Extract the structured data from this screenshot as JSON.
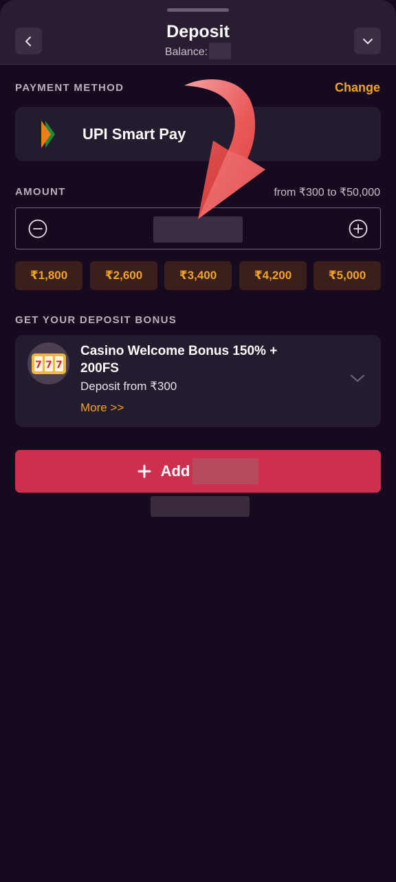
{
  "header": {
    "title": "Deposit",
    "balance_label": "Balance:",
    "back_icon": "chevron-left-icon",
    "collapse_icon": "chevron-down-icon"
  },
  "payment": {
    "section_label": "PAYMENT METHOD",
    "change_label": "Change",
    "method_name": "UPI Smart Pay",
    "method_icon": "upi-logo-icon"
  },
  "amount": {
    "section_label": "AMOUNT",
    "range": "from ₹300 to ₹50,000",
    "quick_amounts": [
      "₹1,800",
      "₹2,600",
      "₹3,400",
      "₹4,200",
      "₹5,000"
    ]
  },
  "bonus": {
    "section_label": "GET YOUR DEPOSIT BONUS",
    "title": "Casino Welcome Bonus 150% + 200FS",
    "subtitle": "Deposit from ₹300",
    "more_label": "More >>",
    "icon": "slot-machine-icon"
  },
  "action": {
    "add_label": "Add"
  },
  "colors": {
    "accent": "#f2a423",
    "primary_button": "#cf2f4f",
    "background": "#160a1f",
    "card": "#251b2e"
  }
}
